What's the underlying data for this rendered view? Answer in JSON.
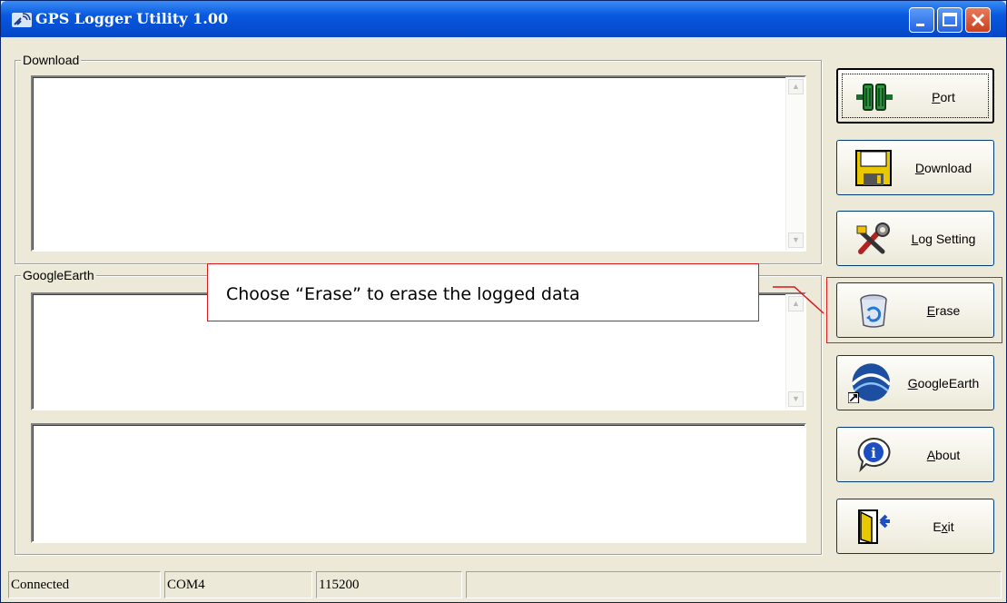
{
  "window": {
    "title": "GPS Logger Utility 1.00"
  },
  "groups": {
    "download": "Download",
    "google_earth": "GoogleEarth"
  },
  "buttons": [
    {
      "id": "port",
      "mnemonic": "P",
      "rest": "ort",
      "icon": "port-connector-icon"
    },
    {
      "id": "download",
      "mnemonic": "D",
      "rest": "ownload",
      "icon": "floppy-disk-icon"
    },
    {
      "id": "log_setting",
      "mnemonic": "L",
      "rest": "og Setting",
      "icon": "tools-icon"
    },
    {
      "id": "erase",
      "mnemonic": "E",
      "rest": "rase",
      "icon": "recycle-bin-icon"
    },
    {
      "id": "googleearth",
      "mnemonic": "G",
      "rest": "oogleEarth",
      "icon": "google-earth-icon"
    },
    {
      "id": "about",
      "mnemonic": "A",
      "rest": "bout",
      "icon": "info-icon"
    },
    {
      "id": "exit",
      "pre": "E",
      "mnemonic": "x",
      "rest": "it",
      "icon": "exit-door-icon"
    }
  ],
  "callout": {
    "text": "Choose “Erase” to erase the logged data"
  },
  "status": {
    "connection": "Connected",
    "port": "COM4",
    "baud": "115200"
  },
  "colors": {
    "titlebar": "#0858e0",
    "callout_border": "#d71920",
    "face": "#ece9d8"
  }
}
